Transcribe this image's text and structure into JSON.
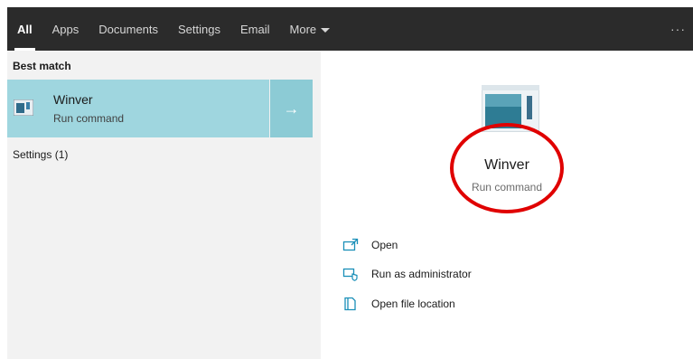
{
  "tabs": [
    {
      "label": "All",
      "active": true
    },
    {
      "label": "Apps"
    },
    {
      "label": "Documents"
    },
    {
      "label": "Settings"
    },
    {
      "label": "Email"
    },
    {
      "label": "More"
    }
  ],
  "more_dots": "···",
  "left": {
    "best_match_label": "Best match",
    "result": {
      "title": "Winver",
      "subtitle": "Run command",
      "arrow": "→"
    },
    "settings_label": "Settings (1)"
  },
  "detail": {
    "title": "Winver",
    "subtitle": "Run command",
    "actions": [
      {
        "label": "Open",
        "icon": "open-icon"
      },
      {
        "label": "Run as administrator",
        "icon": "shield-admin-icon"
      },
      {
        "label": "Open file location",
        "icon": "folder-location-icon"
      }
    ]
  },
  "colors": {
    "tabbar": "#2b2b2b",
    "selected_row": "#9fd6df",
    "highlight_circle": "#e00000",
    "accent_icon": "#1a8fb8"
  }
}
